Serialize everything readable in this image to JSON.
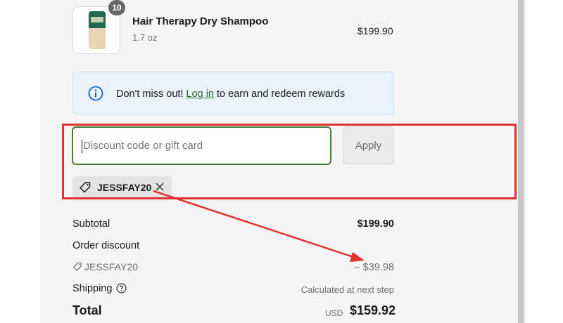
{
  "product": {
    "quantity": "10",
    "title": "Hair Therapy Dry Shampoo",
    "variant": "1.7 oz",
    "price": "$199.90"
  },
  "rewards": {
    "text_before": "Don't miss out! ",
    "link": "Log in",
    "text_after": " to earn and redeem rewards",
    "icon": "info-icon"
  },
  "discount": {
    "placeholder": "Discount code or gift card",
    "value": "",
    "apply_label": "Apply",
    "applied_code": "JESSFAY20"
  },
  "summary": {
    "subtotal_label": "Subtotal",
    "subtotal_value": "$199.90",
    "order_discount_label": "Order discount",
    "discount_code": "JESSFAY20",
    "discount_value": "– $39.98",
    "shipping_label": "Shipping",
    "shipping_value": "Calculated at next step",
    "total_label": "Total",
    "total_currency": "USD",
    "total_value": "$159.92"
  },
  "colors": {
    "annotation": "#e03030",
    "input_focus_border": "#4a7a39",
    "link": "#2b6b2b",
    "rewards_bg": "#eaf3fc"
  }
}
